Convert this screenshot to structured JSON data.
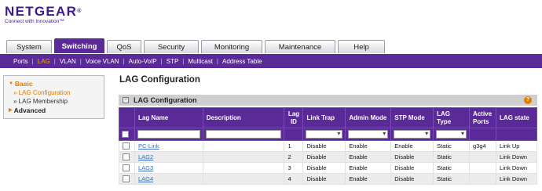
{
  "brand": {
    "logo": "NETGEAR",
    "reg": "®",
    "tagline": "Connect with Innovation™"
  },
  "tabs": [
    {
      "label": "System",
      "active": false,
      "width": 58
    },
    {
      "label": "Switching",
      "active": true,
      "width": 64
    },
    {
      "label": "QoS",
      "active": false,
      "width": 44
    },
    {
      "label": "Security",
      "active": false,
      "width": 70
    },
    {
      "label": "Monitoring",
      "active": false,
      "width": 78
    },
    {
      "label": "Maintenance",
      "active": false,
      "width": 90
    },
    {
      "label": "Help",
      "active": false,
      "width": 60
    }
  ],
  "subnav": [
    {
      "label": "Ports",
      "active": false
    },
    {
      "label": "LAG",
      "active": true
    },
    {
      "label": "VLAN",
      "active": false
    },
    {
      "label": "Voice VLAN",
      "active": false
    },
    {
      "label": "Auto-VoIP",
      "active": false
    },
    {
      "label": "STP",
      "active": false
    },
    {
      "label": "Multicast",
      "active": false
    },
    {
      "label": "Address Table",
      "active": false
    }
  ],
  "leftnav": {
    "basic": "Basic",
    "items": [
      "LAG Configuration",
      "LAG Membership"
    ],
    "advanced": "Advanced"
  },
  "page_title": "LAG Configuration",
  "panel_title": "LAG Configuration",
  "help_icon": "?",
  "table": {
    "headers": [
      "Lag Name",
      "Description",
      "Lag ID",
      "Link Trap",
      "Admin Mode",
      "STP Mode",
      "LAG Type",
      "Active Ports",
      "LAG state"
    ],
    "rows": [
      {
        "name": "PC-Link",
        "description": "",
        "id": "1",
        "link_trap": "Disable",
        "admin_mode": "Enable",
        "stp_mode": "Enable",
        "lag_type": "Static",
        "active_ports": "g3g4",
        "state": "Link Up"
      },
      {
        "name": "LAG2",
        "description": "",
        "id": "2",
        "link_trap": "Disable",
        "admin_mode": "Enable",
        "stp_mode": "Disable",
        "lag_type": "Static",
        "active_ports": "",
        "state": "Link Down"
      },
      {
        "name": "LAG3",
        "description": "",
        "id": "3",
        "link_trap": "Disable",
        "admin_mode": "Enable",
        "stp_mode": "Disable",
        "lag_type": "Static",
        "active_ports": "",
        "state": "Link Down"
      },
      {
        "name": "LAG4",
        "description": "",
        "id": "4",
        "link_trap": "Disable",
        "admin_mode": "Enable",
        "stp_mode": "Disable",
        "lag_type": "Static",
        "active_ports": "",
        "state": "Link Down"
      }
    ]
  },
  "colors": {
    "brand_purple": "#5b2a99",
    "accent_orange": "#e37b00",
    "link_blue": "#3a6fbf"
  }
}
